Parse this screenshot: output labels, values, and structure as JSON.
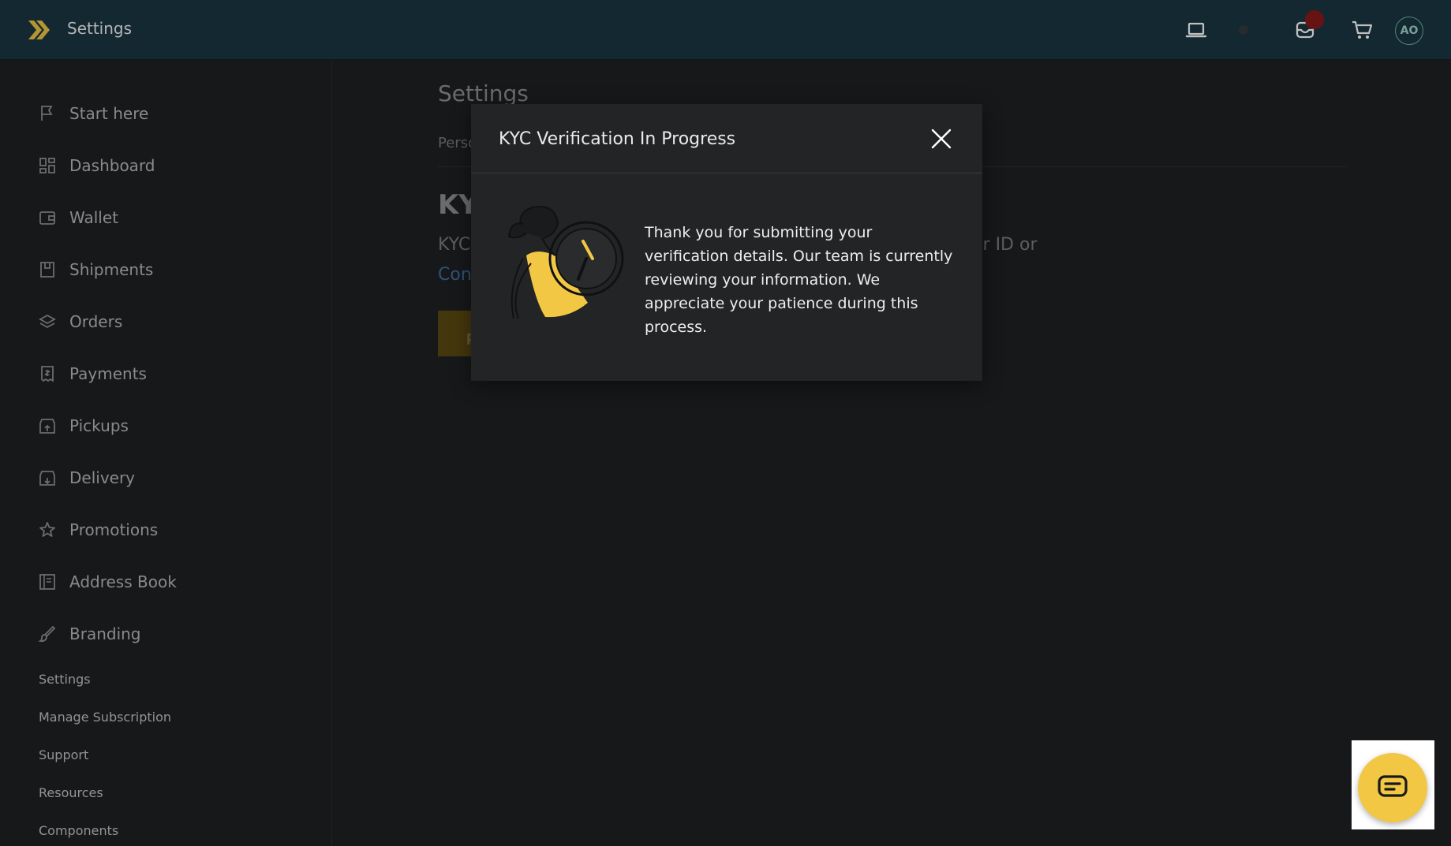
{
  "app": {
    "title": "Settings"
  },
  "header": {
    "avatar_initials": "AO"
  },
  "sidebar": {
    "items": [
      {
        "label": "Start here",
        "icon": "flag-icon"
      },
      {
        "label": "Dashboard",
        "icon": "dashboard-icon"
      },
      {
        "label": "Wallet",
        "icon": "wallet-icon"
      },
      {
        "label": "Shipments",
        "icon": "box-icon"
      },
      {
        "label": "Orders",
        "icon": "layers-icon"
      },
      {
        "label": "Payments",
        "icon": "receipt-icon"
      },
      {
        "label": "Pickups",
        "icon": "store-upload-icon"
      },
      {
        "label": "Delivery",
        "icon": "store-download-icon"
      },
      {
        "label": "Promotions",
        "icon": "star-icon"
      },
      {
        "label": "Address Book",
        "icon": "book-icon"
      },
      {
        "label": "Branding",
        "icon": "brush-icon"
      }
    ],
    "links": [
      "Settings",
      "Manage Subscription",
      "Support",
      "Resources",
      "Components"
    ]
  },
  "main": {
    "page_title": "Settings",
    "tab_partial": "Perso",
    "heading_partial": "KY",
    "text_left_partial": "KYC",
    "text_right_partial": "er ID or",
    "link_partial": "Con",
    "button_partial": "P"
  },
  "modal": {
    "title": "KYC Verification In Progress",
    "message": "Thank you for submitting your verification details. Our team is currently reviewing your information. We appreciate your patience during this process."
  },
  "colors": {
    "topbar": "#1a3642",
    "accent": "#f2c744",
    "background": "#1f2023",
    "link": "#3f6ea0"
  }
}
